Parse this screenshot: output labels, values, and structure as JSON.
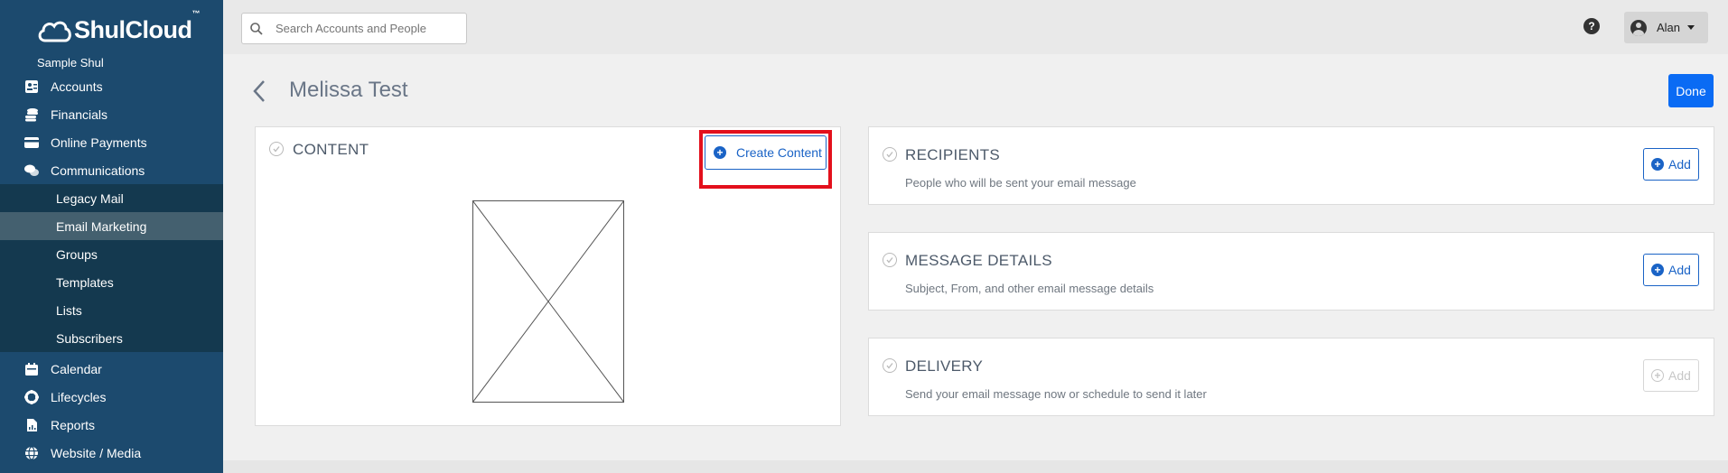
{
  "brand": {
    "name": "ShulCloud",
    "tm": "™",
    "org": "Sample Shul"
  },
  "sidebar": {
    "items": [
      {
        "label": "Accounts",
        "icon": "address-card-icon"
      },
      {
        "label": "Financials",
        "icon": "coins-icon"
      },
      {
        "label": "Online Payments",
        "icon": "credit-card-icon"
      },
      {
        "label": "Communications",
        "icon": "comments-icon"
      }
    ],
    "sub_items": [
      {
        "label": "Legacy Mail",
        "active": false
      },
      {
        "label": "Email Marketing",
        "active": true
      },
      {
        "label": "Groups",
        "active": false
      },
      {
        "label": "Templates",
        "active": false
      },
      {
        "label": "Lists",
        "active": false
      },
      {
        "label": "Subscribers",
        "active": false
      }
    ],
    "items_after": [
      {
        "label": "Calendar",
        "icon": "calendar-icon"
      },
      {
        "label": "Lifecycles",
        "icon": "lifecycle-icon"
      },
      {
        "label": "Reports",
        "icon": "report-icon"
      },
      {
        "label": "Website / Media",
        "icon": "globe-icon"
      }
    ]
  },
  "search": {
    "placeholder": "Search Accounts and People"
  },
  "header": {
    "help": "?",
    "user": "Alan"
  },
  "page": {
    "title": "Melissa Test",
    "done_label": "Done"
  },
  "content_card": {
    "title": "CONTENT",
    "button_label": "Create Content",
    "highlight_color": "#e3101c"
  },
  "sections": [
    {
      "title": "RECIPIENTS",
      "description": "People who will be sent your email message",
      "add_label": "Add",
      "enabled": true
    },
    {
      "title": "MESSAGE DETAILS",
      "description": "Subject, From, and other email message details",
      "add_label": "Add",
      "enabled": true
    },
    {
      "title": "DELIVERY",
      "description": "Send your email message now or schedule to send it later",
      "add_label": "Add",
      "enabled": false
    }
  ],
  "colors": {
    "sidebar": "#1c4a6e",
    "subnav": "#14394f",
    "active_sub": "#44606f",
    "primary": "#0a6bf4",
    "link": "#1a63c6"
  }
}
